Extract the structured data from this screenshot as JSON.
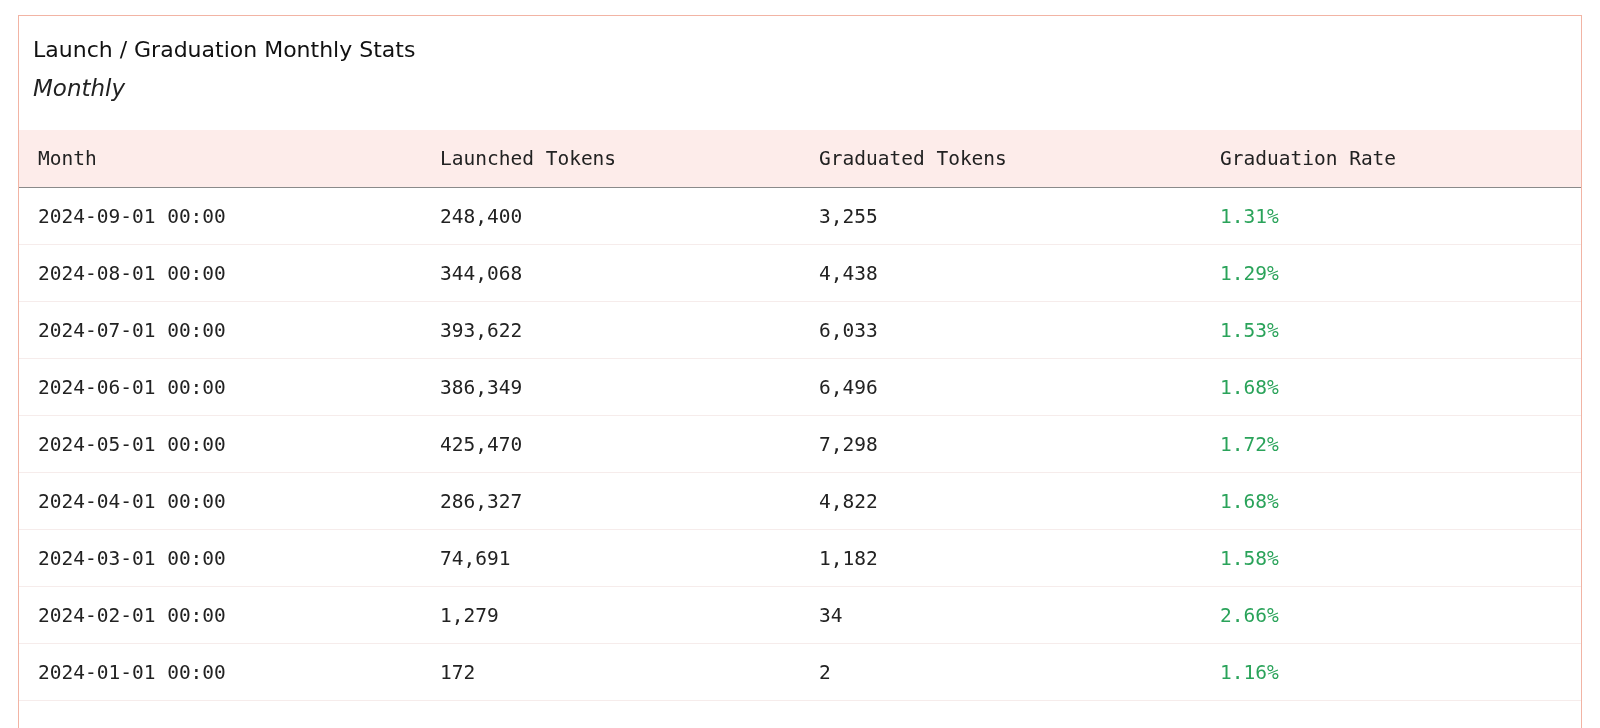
{
  "card": {
    "title": "Launch / Graduation Monthly Stats",
    "subtitle": "Monthly"
  },
  "table": {
    "columns": [
      "Month",
      "Launched Tokens",
      "Graduated Tokens",
      "Graduation Rate"
    ],
    "rows": [
      [
        "2024-09-01 00:00",
        "248,400",
        "3,255",
        "1.31%"
      ],
      [
        "2024-08-01 00:00",
        "344,068",
        "4,438",
        "1.29%"
      ],
      [
        "2024-07-01 00:00",
        "393,622",
        "6,033",
        "1.53%"
      ],
      [
        "2024-06-01 00:00",
        "386,349",
        "6,496",
        "1.68%"
      ],
      [
        "2024-05-01 00:00",
        "425,470",
        "7,298",
        "1.72%"
      ],
      [
        "2024-04-01 00:00",
        "286,327",
        "4,822",
        "1.68%"
      ],
      [
        "2024-03-01 00:00",
        "74,691",
        "1,182",
        "1.58%"
      ],
      [
        "2024-02-01 00:00",
        "1,279",
        "34",
        "2.66%"
      ],
      [
        "2024-01-01 00:00",
        "172",
        "2",
        "1.16%"
      ]
    ]
  }
}
